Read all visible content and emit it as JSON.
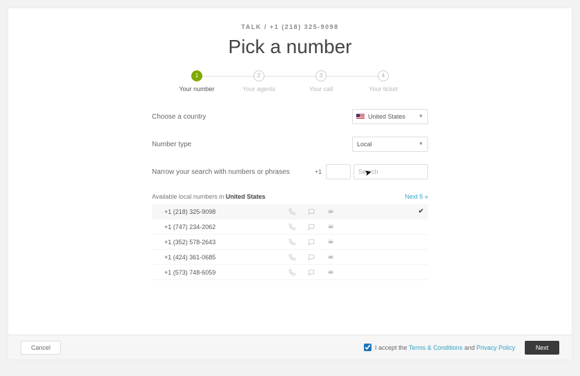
{
  "breadcrumb": "TALK / +1 (218) 325-9098",
  "title": "Pick a number",
  "steps": [
    {
      "num": "1",
      "label": "Your number",
      "active": true
    },
    {
      "num": "2",
      "label": "Your agents",
      "active": false
    },
    {
      "num": "3",
      "label": "Your call",
      "active": false
    },
    {
      "num": "4",
      "label": "Your ticket",
      "active": false
    }
  ],
  "form": {
    "country_label": "Choose a country",
    "country_value": "United States",
    "type_label": "Number type",
    "type_value": "Local",
    "narrow_label": "Narrow your search with numbers or phrases",
    "prefix": "+1",
    "search_placeholder": "Search"
  },
  "list": {
    "header_prefix": "Available local numbers in ",
    "header_country": "United States",
    "next_label": "Next 5 »",
    "rows": [
      {
        "number": "+1 (218) 325-9098",
        "selected": true
      },
      {
        "number": "+1 (747) 234-2062",
        "selected": false
      },
      {
        "number": "+1 (352) 578-2643",
        "selected": false
      },
      {
        "number": "+1 (424) 361-0685",
        "selected": false
      },
      {
        "number": "+1 (573) 748-6059",
        "selected": false
      }
    ]
  },
  "footer": {
    "cancel": "Cancel",
    "accept_prefix": "I accept the ",
    "terms": "Terms & Conditions",
    "and": " and ",
    "privacy": "Privacy Policy",
    "next": "Next",
    "accepted": true
  }
}
